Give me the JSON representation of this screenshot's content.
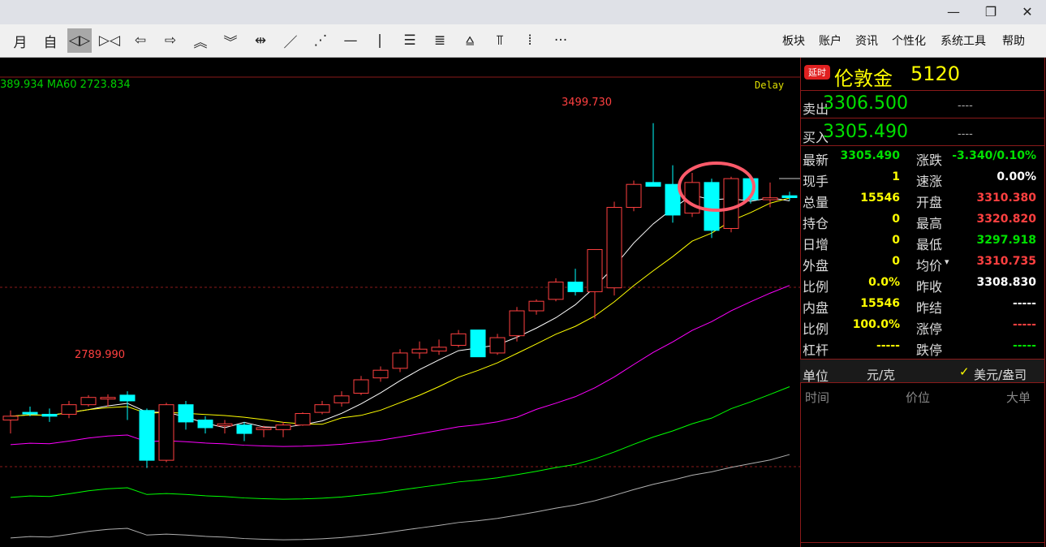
{
  "window": {
    "minimize": "—",
    "restore": "❐",
    "close": "✕"
  },
  "toolbar": {
    "tools": [
      {
        "icon": "month-period-icon",
        "glyph": "月",
        "active": false
      },
      {
        "icon": "custom-period-icon",
        "glyph": "自",
        "active": false
      },
      {
        "icon": "zoom-in-icon",
        "glyph": "◁▷",
        "active": true
      },
      {
        "icon": "zoom-out-icon",
        "glyph": "▷◁",
        "active": false
      },
      {
        "icon": "scroll-left-icon",
        "glyph": "⇦",
        "active": false
      },
      {
        "icon": "scroll-right-icon",
        "glyph": "⇨",
        "active": false
      },
      {
        "icon": "chevron-up-icon",
        "glyph": "︽",
        "active": false
      },
      {
        "icon": "chevron-down-icon",
        "glyph": "︾",
        "active": false
      },
      {
        "icon": "crosshair-icon",
        "glyph": "⇹",
        "active": false
      },
      {
        "icon": "line-tool-icon",
        "glyph": "／",
        "active": false
      },
      {
        "icon": "dashed-line-tool-icon",
        "glyph": "⋰",
        "active": false
      },
      {
        "icon": "horizontal-line-icon",
        "glyph": "—",
        "active": false
      },
      {
        "icon": "vertical-line-icon",
        "glyph": "|",
        "active": false
      },
      {
        "icon": "parallel-lines-icon",
        "glyph": "☰",
        "active": false
      },
      {
        "icon": "fibonacci-icon",
        "glyph": "≣",
        "active": false
      },
      {
        "icon": "fan-lines-icon",
        "glyph": "⩠",
        "active": false
      },
      {
        "icon": "period-lines-icon",
        "glyph": "⫪",
        "active": false
      },
      {
        "icon": "gann-lines-icon",
        "glyph": "⦙",
        "active": false
      },
      {
        "icon": "more-icon",
        "glyph": "···",
        "active": false
      }
    ],
    "menus": [
      "板块",
      "账户",
      "资讯",
      "个性化",
      "系统工具",
      "帮助"
    ]
  },
  "chart": {
    "ma_header": "389.934  MA60 2723.834",
    "delay": "Delay",
    "high_label": "3499.730",
    "low_label": "2789.990",
    "up_color": "#ff4040",
    "down_color": "#00ffff"
  },
  "chart_data": {
    "type": "candlestick",
    "price_range": [
      2400,
      3620
    ],
    "candles": [
      [
        2725,
        2750,
        2690,
        2735
      ],
      [
        2745,
        2760,
        2735,
        2742
      ],
      [
        2740,
        2755,
        2720,
        2735
      ],
      [
        2740,
        2775,
        2730,
        2765
      ],
      [
        2765,
        2790,
        2760,
        2784
      ],
      [
        2784,
        2792,
        2760,
        2784
      ],
      [
        2790,
        2800,
        2725,
        2775
      ],
      [
        2750,
        2755,
        2600,
        2620
      ],
      [
        2620,
        2770,
        2615,
        2765
      ],
      [
        2765,
        2775,
        2700,
        2720
      ],
      [
        2725,
        2735,
        2690,
        2705
      ],
      [
        2710,
        2725,
        2690,
        2715
      ],
      [
        2712,
        2720,
        2670,
        2690
      ],
      [
        2700,
        2710,
        2680,
        2705
      ],
      [
        2700,
        2720,
        2680,
        2712
      ],
      [
        2712,
        2745,
        2710,
        2742
      ],
      [
        2745,
        2775,
        2740,
        2765
      ],
      [
        2770,
        2800,
        2760,
        2788
      ],
      [
        2795,
        2840,
        2790,
        2830
      ],
      [
        2835,
        2865,
        2825,
        2855
      ],
      [
        2860,
        2910,
        2850,
        2900
      ],
      [
        2900,
        2930,
        2885,
        2910
      ],
      [
        2905,
        2935,
        2895,
        2915
      ],
      [
        2920,
        2960,
        2915,
        2950
      ],
      [
        2960,
        2935,
        2890,
        2890
      ],
      [
        2900,
        2950,
        2895,
        2940
      ],
      [
        2945,
        3020,
        2930,
        3010
      ],
      [
        3010,
        3040,
        3000,
        3035
      ],
      [
        3040,
        3095,
        3035,
        3085
      ],
      [
        3085,
        3120,
        3050,
        3060
      ],
      [
        3060,
        3120,
        2990,
        3170
      ],
      [
        3070,
        3295,
        3050,
        3280
      ],
      [
        3280,
        3350,
        3270,
        3340
      ],
      [
        3345,
        3499.73,
        3335,
        3335
      ],
      [
        3340,
        3390,
        3240,
        3260
      ],
      [
        3265,
        3370,
        3255,
        3345
      ],
      [
        3345,
        3355,
        3200,
        3220
      ],
      [
        3225,
        3360,
        3215,
        3355
      ],
      [
        3355,
        3360,
        3290,
        3300
      ],
      [
        3300,
        3345,
        3280,
        3305
      ],
      [
        3310.38,
        3320.82,
        3297.92,
        3305.49
      ]
    ]
  },
  "panel": {
    "badge": "延时",
    "title": "伦敦金",
    "code": "5120",
    "sell_label": "卖出",
    "sell_price": "3306.500",
    "sell_vol": "----",
    "buy_label": "买入",
    "buy_price": "3305.490",
    "buy_vol": "----",
    "rows": [
      {
        "l1": "最新",
        "v1": "3305.490",
        "c1": "#00e000",
        "l2": "涨跌",
        "v2": "-3.340/0.10%",
        "c2": "#00e000"
      },
      {
        "l1": "现手",
        "v1": "1",
        "c1": "#ffff00",
        "l2": "速涨",
        "v2": "0.00%",
        "c2": "#ffffff"
      },
      {
        "l1": "总量",
        "v1": "15546",
        "c1": "#ffff00",
        "l2": "开盘",
        "v2": "3310.380",
        "c2": "#ff4040"
      },
      {
        "l1": "持仓",
        "v1": "0",
        "c1": "#ffff00",
        "l2": "最高",
        "v2": "3320.820",
        "c2": "#ff4040"
      },
      {
        "l1": "日增",
        "v1": "0",
        "c1": "#ffff00",
        "l2": "最低",
        "v2": "3297.918",
        "c2": "#00e000"
      },
      {
        "l1": "外盘",
        "v1": "0",
        "c1": "#ffff00",
        "l2": "均价",
        "v2": "3310.735",
        "c2": "#ff4040"
      },
      {
        "l1": "比例",
        "v1": "0.0%",
        "c1": "#ffff00",
        "l2": "昨收",
        "v2": "3308.830",
        "c2": "#ffffff"
      },
      {
        "l1": "内盘",
        "v1": "15546",
        "c1": "#ffff00",
        "l2": "昨结",
        "v2": "-----",
        "c2": "#ffffff"
      },
      {
        "l1": "比例",
        "v1": "100.0%",
        "c1": "#ffff00",
        "l2": "涨停",
        "v2": "-----",
        "c2": "#ff4040"
      },
      {
        "l1": "杠杆",
        "v1": "-----",
        "c1": "#ffff00",
        "l2": "跌停",
        "v2": "-----",
        "c2": "#00e000"
      }
    ],
    "unit_label": "单位",
    "unit_value": "元/克",
    "unit_check": "✓",
    "unit_alt": "美元/盎司",
    "tick_headers": [
      "时间",
      "价位",
      "大单"
    ]
  }
}
